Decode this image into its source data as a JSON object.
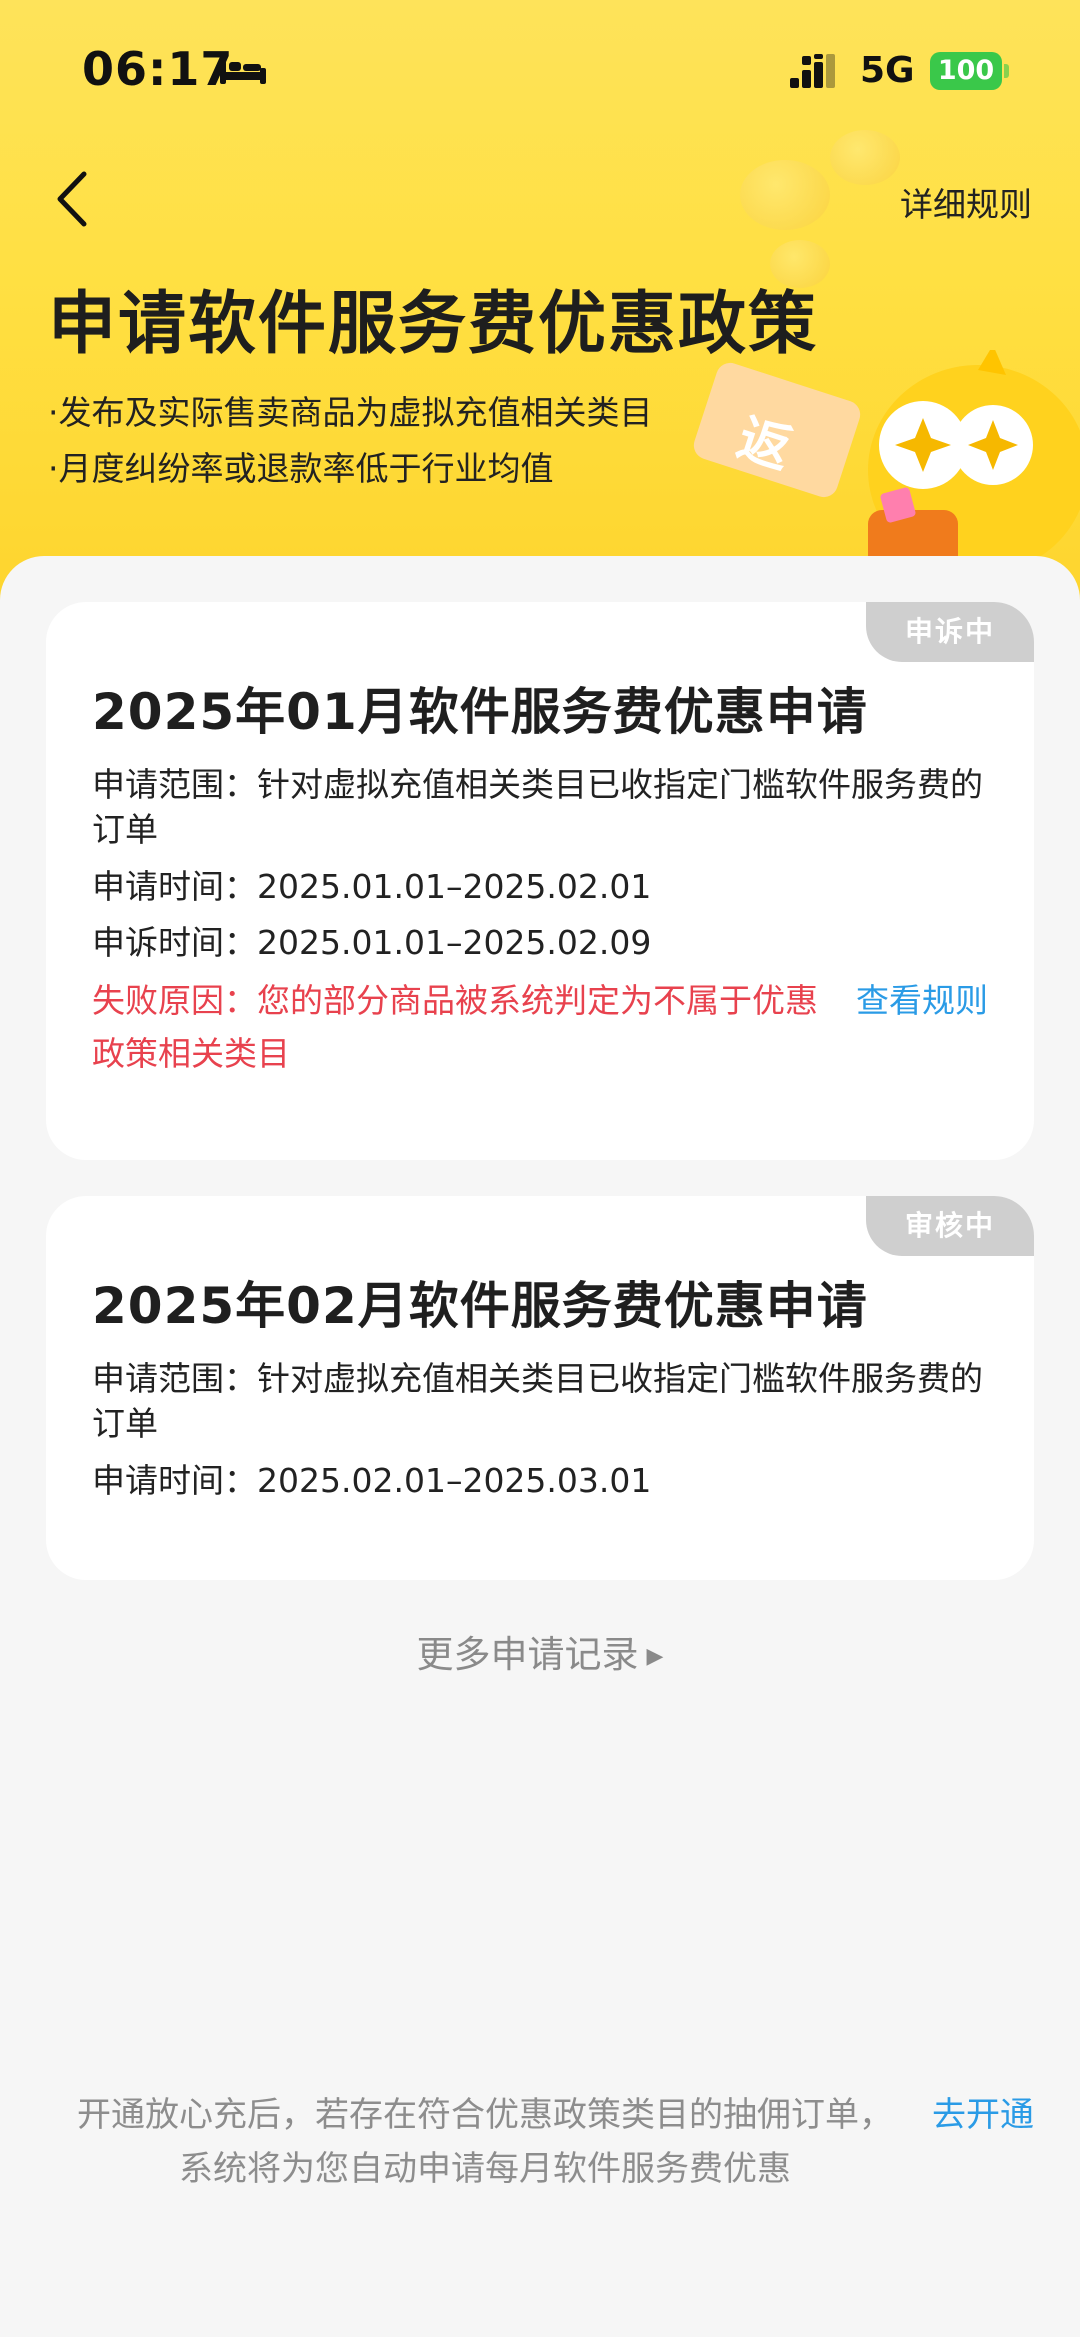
{
  "status_bar": {
    "time": "06:17",
    "network": "5G",
    "battery": "100"
  },
  "header": {
    "rules_link": "详细规则",
    "title": "申请软件服务费优惠政策",
    "bullets": [
      "·发布及实际售卖商品为虚拟充值相关类目",
      "·月度纠纷率或退款率低于行业均值"
    ],
    "voucher_text": "返"
  },
  "applications": [
    {
      "badge": "申诉中",
      "title": "2025年01月软件服务费优惠申请",
      "scope": "申请范围：针对虚拟充值相关类目已收指定门槛软件服务费的订单",
      "apply_time": "申请时间：2025.01.01–2025.02.01",
      "appeal_time": "申诉时间：2025.01.01–2025.02.09",
      "fail_reason": "失败原因：您的部分商品被系统判定为不属于优惠政策相关类目",
      "view_rules": "查看规则"
    },
    {
      "badge": "审核中",
      "title": "2025年02月软件服务费优惠申请",
      "scope": "申请范围：针对虚拟充值相关类目已收指定门槛软件服务费的订单",
      "apply_time": "申请时间：2025.02.01–2025.03.01"
    }
  ],
  "more_records": "更多申请记录",
  "footer": {
    "text": "开通放心充后，若存在符合优惠政策类目的抽佣订单，系统将为您自动申请每月软件服务费优惠",
    "activate": "去开通"
  },
  "colors": {
    "hero_yellow": "#fee35a",
    "error_red": "#e8424e",
    "link_blue": "#2a9be6",
    "badge_gray": "#cfcfcf",
    "battery_green": "#3ac84a"
  },
  "icons": [
    "bed-icon",
    "signal-icon",
    "back-icon",
    "play-arrow-icon"
  ]
}
